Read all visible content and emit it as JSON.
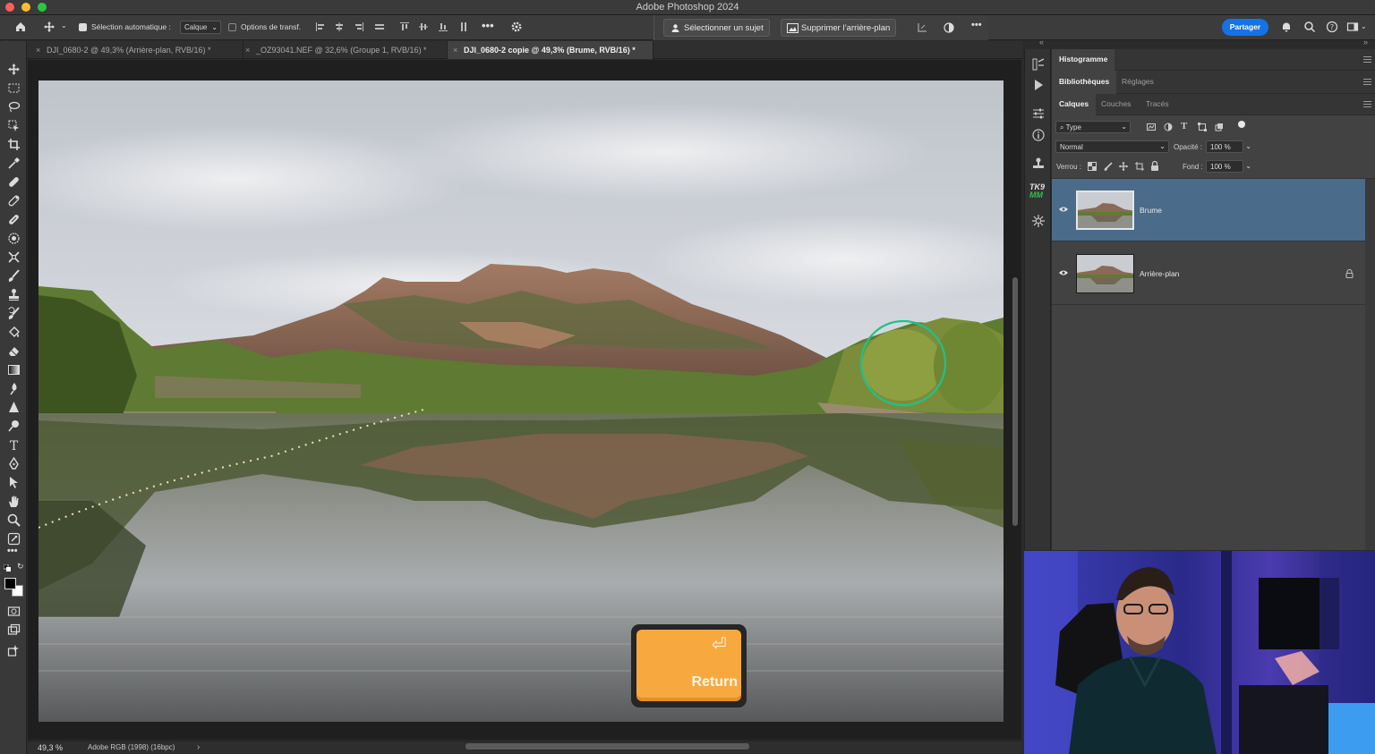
{
  "app": {
    "title": "Adobe Photoshop 2024"
  },
  "options_bar": {
    "auto_select_label": "Sélection automatique :",
    "auto_select_checked": true,
    "auto_select_value": "Calque",
    "transform_label": "Options de transf.",
    "transform_checked": false,
    "select_subject_label": "Sélectionner un sujet",
    "remove_bg_label": "Supprimer l’arrière-plan",
    "share_label": "Partager"
  },
  "document_tabs": [
    {
      "label": "DJI_0680-2 @ 49,3% (Arrière-plan, RVB/16) *",
      "active": false
    },
    {
      "label": "_OZ93041.NEF @ 32,6% (Groupe 1, RVB/16) *",
      "active": false
    },
    {
      "label": "DJI_0680-2 copie @ 49,3% (Brume, RVB/16) *",
      "active": true
    }
  ],
  "status": {
    "zoom": "49,3 %",
    "profile": "Adobe RGB (1998) (16bpc)",
    "arrow": "›"
  },
  "overlay_key": {
    "label": "Return",
    "symbol": "⏎"
  },
  "panels": {
    "row1": {
      "tabs": [
        "Histogramme"
      ],
      "active": "Histogramme"
    },
    "row2": {
      "tabs": [
        "Bibliothèques",
        "Réglages"
      ],
      "active": "Bibliothèques"
    },
    "row3": {
      "tabs": [
        "Calques",
        "Couches",
        "Tracés"
      ],
      "active": "Calques"
    },
    "filter_select": "Type",
    "blend_mode": "Normal",
    "opacity_label": "Opacité :",
    "opacity_value": "100 %",
    "lock_label": "Verrou :",
    "fill_label": "Fond :",
    "fill_value": "100 %",
    "layers": [
      {
        "name": "Brume",
        "selected": true,
        "visible": true,
        "locked": false
      },
      {
        "name": "Arrière-plan",
        "selected": false,
        "visible": true,
        "locked": true
      }
    ]
  },
  "strip_icons": [
    "brush-settings-icon",
    "play-icon",
    "adjustments-icon",
    "info-icon",
    "clone-source-icon",
    "tk9-plugin-icon",
    "sparkle-icon"
  ],
  "plugin_badge": {
    "line1": "TK9",
    "line2": "MM"
  },
  "colors": {
    "accent": "#1473e6",
    "selected_layer": "#4a6b8a",
    "brush_cursor": "#1ec28b",
    "return_key": "#f7a93f"
  }
}
